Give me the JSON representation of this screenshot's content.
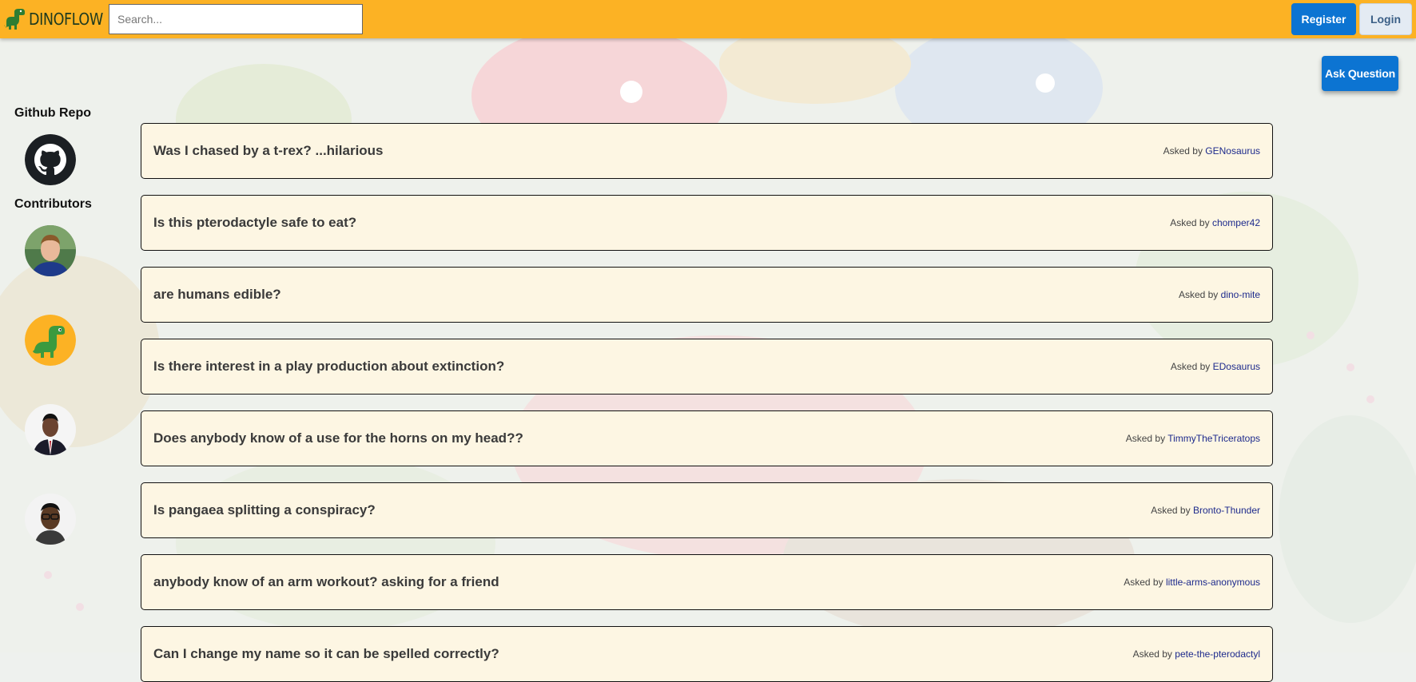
{
  "header": {
    "logo_text": "DINOFLOW",
    "search_placeholder": "Search...",
    "register_label": "Register",
    "login_label": "Login",
    "brand_color": "#fcb224",
    "primary_color": "#0c74d2"
  },
  "main": {
    "ask_question_label": "Ask Question"
  },
  "sidebar": {
    "github_heading": "Github Repo",
    "contributors_heading": "Contributors",
    "contributors": [
      {
        "avatar": "contributor-photo"
      },
      {
        "avatar": "green-dinosaur"
      },
      {
        "avatar": "contributor-photo"
      },
      {
        "avatar": "contributor-photo"
      }
    ]
  },
  "questions": [
    {
      "title": "Was I chased by a t-rex? ...hilarious",
      "asked_by": "Asked by",
      "author": "GENosaurus"
    },
    {
      "title": "Is this pterodactyle safe to eat?",
      "asked_by": "Asked by",
      "author": "chomper42"
    },
    {
      "title": "are humans edible?",
      "asked_by": "Asked by",
      "author": "dino-mite"
    },
    {
      "title": "Is there interest in a play production about extinction?",
      "asked_by": "Asked by",
      "author": "EDosaurus"
    },
    {
      "title": "Does anybody know of a use for the horns on my head??",
      "asked_by": "Asked by",
      "author": "TimmyTheTriceratops"
    },
    {
      "title": "Is pangaea splitting a conspiracy?",
      "asked_by": "Asked by",
      "author": "Bronto-Thunder"
    },
    {
      "title": "anybody know of an arm workout? asking for a friend",
      "asked_by": "Asked by",
      "author": "little-arms-anonymous"
    },
    {
      "title": "Can I change my name so it can be spelled correctly?",
      "asked_by": "Asked by",
      "author": "pete-the-pterodactyl"
    }
  ]
}
